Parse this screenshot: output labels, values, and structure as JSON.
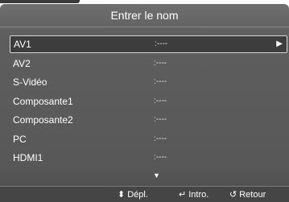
{
  "title": "Entrer le nom",
  "items": [
    {
      "name": "AV1",
      "value": ":----",
      "selected": true
    },
    {
      "name": "AV2",
      "value": ":----",
      "selected": false
    },
    {
      "name": "S-Vidéo",
      "value": ":----",
      "selected": false
    },
    {
      "name": "Composante1",
      "value": ":----",
      "selected": false
    },
    {
      "name": "Composante2",
      "value": ":----",
      "selected": false
    },
    {
      "name": "PC",
      "value": ":----",
      "selected": false
    },
    {
      "name": "HDMI1",
      "value": ":----",
      "selected": false
    }
  ],
  "icons": {
    "submenu_arrow": "▶",
    "scroll_down": "▼",
    "move": "⬍",
    "enter": "↵",
    "return": "↺"
  },
  "footer": {
    "move_label": "Dépl.",
    "enter_label": "Intro.",
    "return_label": "Retour"
  },
  "colors": {
    "panel": "#5e5e5e",
    "highlight_border": "#d8d8d8",
    "text": "#ffffff"
  }
}
